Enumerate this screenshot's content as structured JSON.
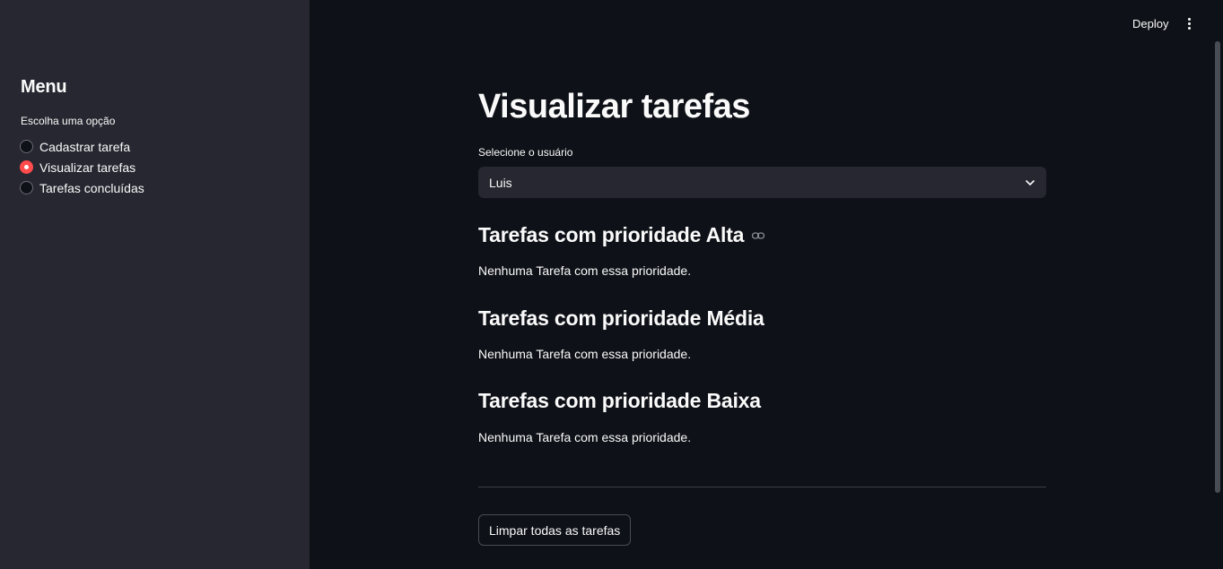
{
  "header": {
    "deploy_label": "Deploy",
    "menu_icon": "kebab-vertical-icon"
  },
  "sidebar": {
    "title": "Menu",
    "radio_label": "Escolha uma opção",
    "options": [
      {
        "label": "Cadastrar tarefa",
        "selected": false
      },
      {
        "label": "Visualizar tarefas",
        "selected": true
      },
      {
        "label": "Tarefas concluídas",
        "selected": false
      }
    ]
  },
  "main": {
    "title": "Visualizar tarefas",
    "user_select": {
      "label": "Selecione o usuário",
      "value": "Luis"
    },
    "sections": [
      {
        "heading": "Tarefas com prioridade Alta",
        "text": "Nenhuma Tarefa com essa prioridade."
      },
      {
        "heading": "Tarefas com prioridade Média",
        "text": "Nenhuma Tarefa com essa prioridade."
      },
      {
        "heading": "Tarefas com prioridade Baixa",
        "text": "Nenhuma Tarefa com essa prioridade."
      }
    ],
    "clear_button_label": "Limpar todas as tarefas"
  },
  "colors": {
    "background": "#0e1117",
    "sidebar": "#262730",
    "accent": "#ff4b4b",
    "text": "#fafafa"
  }
}
